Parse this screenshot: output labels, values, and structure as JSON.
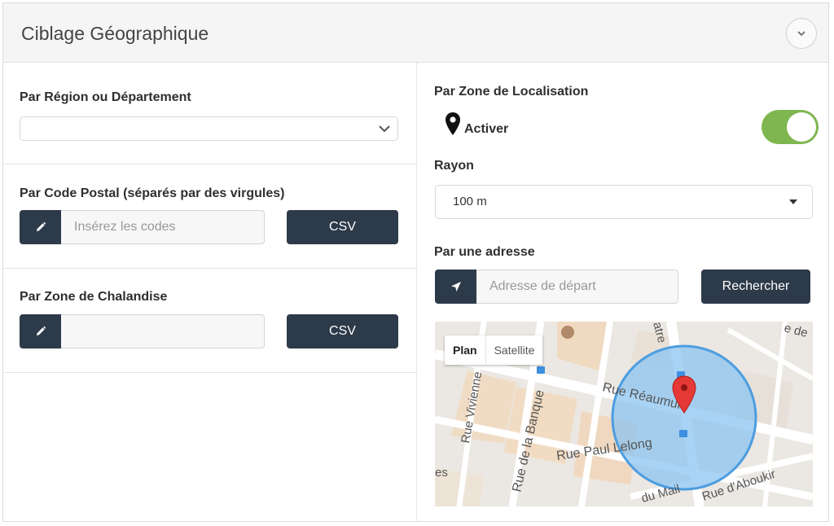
{
  "header": {
    "title": "Ciblage Géographique"
  },
  "left": {
    "region": {
      "label": "Par Région ou Département",
      "value": ""
    },
    "postal": {
      "label": "Par Code Postal (séparés par des virgules)",
      "placeholder": "Insérez les codes",
      "csv_label": "CSV"
    },
    "chalandise": {
      "label": "Par Zone de Chalandise",
      "value": "",
      "csv_label": "CSV"
    }
  },
  "right": {
    "localisation": {
      "label": "Par Zone de Localisation",
      "activer_label": "Activer",
      "toggle_on": true,
      "toggle_color": "#7fb650"
    },
    "rayon": {
      "label": "Rayon",
      "value": "100 m"
    },
    "adresse": {
      "label": "Par une adresse",
      "placeholder": "Adresse de départ",
      "search_label": "Rechercher"
    },
    "map": {
      "tabs": [
        "Plan",
        "Satellite"
      ],
      "active_tab": "Plan",
      "street_labels": [
        "Rue Réaumur",
        "Rue Paul Lelong",
        "Rue de la Banque",
        "Rue Vivienne",
        "Rue d'Aboukir",
        "du Mail",
        "atre",
        "e de",
        "es"
      ]
    }
  },
  "colors": {
    "accent_dark": "#2d3a4a",
    "toggle_on": "#7fb650",
    "radius_fill": "#8cc4f0"
  }
}
